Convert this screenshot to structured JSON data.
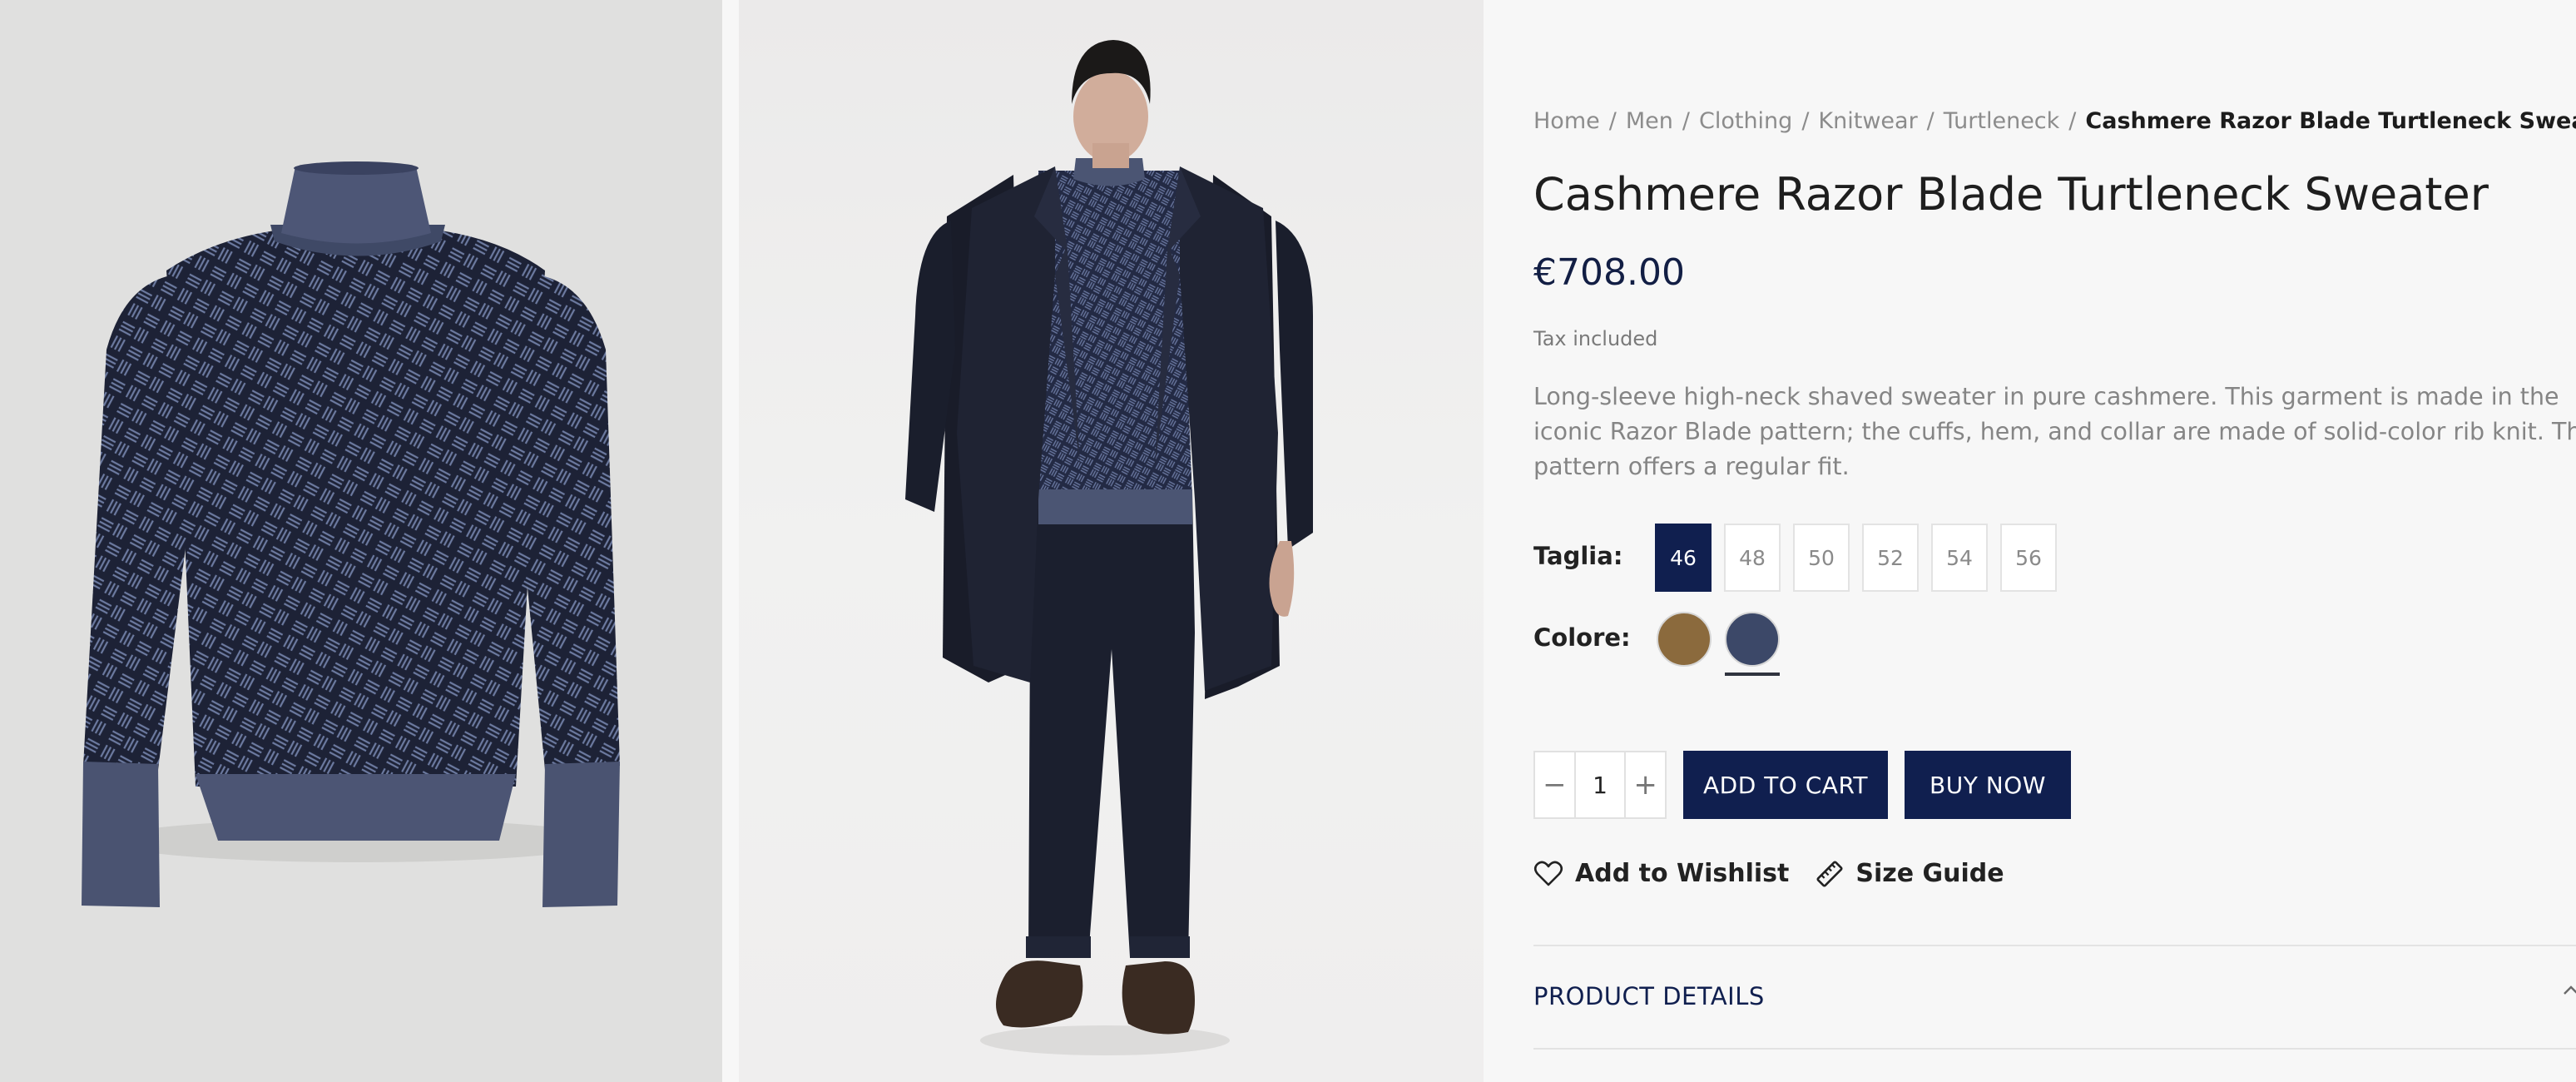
{
  "breadcrumb": {
    "items": [
      "Home",
      "Men",
      "Clothing",
      "Knitwear",
      "Turtleneck"
    ],
    "separator": "/",
    "current": "Cashmere Razor Blade Turtleneck Sweater"
  },
  "product": {
    "title": "Cashmere Razor Blade Turtleneck Sweater",
    "price": "€708.00",
    "tax_note": "Tax included",
    "description": "Long-sleeve high-neck shaved sweater in pure cashmere. This garment is made in the iconic Razor Blade pattern; the cuffs, hem, and collar are made of solid-color rib knit. This pattern offers a regular fit."
  },
  "options": {
    "size_label": "Taglia:",
    "sizes": [
      "46",
      "48",
      "50",
      "52",
      "54",
      "56"
    ],
    "selected_size": "46",
    "color_label": "Colore:",
    "colors": [
      {
        "name": "camel",
        "hex": "#8b6a3d",
        "selected": false
      },
      {
        "name": "blue",
        "hex": "#3c4868",
        "selected": true
      }
    ]
  },
  "quantity": {
    "minus": "−",
    "value": "1",
    "plus": "+"
  },
  "actions": {
    "add_to_cart": "ADD TO CART",
    "buy_now": "BUY NOW"
  },
  "links": {
    "wishlist": "Add to Wishlist",
    "size_guide": "Size Guide"
  },
  "accordion": {
    "product_details": "PRODUCT DETAILS"
  },
  "icons": {
    "wishlist": "heart-icon",
    "size_guide": "ruler-icon",
    "accordion": "chevron-up-icon"
  },
  "colors": {
    "brand": "#101f4f",
    "page_bg": "#f7f7f7"
  }
}
